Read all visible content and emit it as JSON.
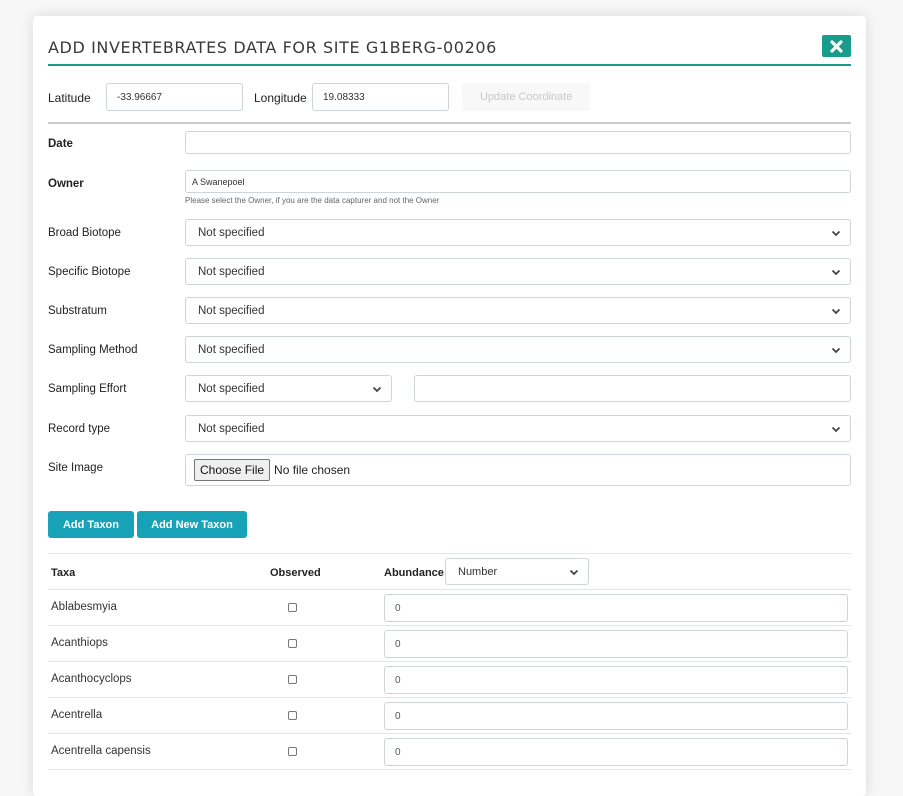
{
  "modal": {
    "title": "ADD INVERTEBRATES DATA FOR SITE G1BERG-00206",
    "close_icon": "close-icon",
    "accent_color": "#1a9c8c"
  },
  "coordinates": {
    "latitude_label": "Latitude",
    "latitude_value": "-33.96667",
    "longitude_label": "Longitude",
    "longitude_value": "19.08333",
    "update_button": "Update Coordinate"
  },
  "form": {
    "date": {
      "label": "Date",
      "value": ""
    },
    "owner": {
      "label": "Owner",
      "value": "A Swanepoel",
      "help": "Please select the Owner, if you are the data capturer and not the Owner"
    },
    "broad_biotope": {
      "label": "Broad Biotope",
      "value": "Not specified"
    },
    "specific_biotope": {
      "label": "Specific Biotope",
      "value": "Not specified"
    },
    "substratum": {
      "label": "Substratum",
      "value": "Not specified"
    },
    "sampling_method": {
      "label": "Sampling Method",
      "value": "Not specified"
    },
    "sampling_effort": {
      "label": "Sampling Effort",
      "value": "Not specified",
      "amount": ""
    },
    "record_type": {
      "label": "Record type",
      "value": "Not specified"
    },
    "site_image": {
      "label": "Site Image",
      "button": "Choose File",
      "status": "No file chosen"
    }
  },
  "actions": {
    "add_taxon": "Add Taxon",
    "add_new_taxon": "Add New Taxon",
    "button_color": "#17a2b8"
  },
  "taxa_table": {
    "headers": {
      "taxa": "Taxa",
      "observed": "Observed",
      "abundance": "Abundance"
    },
    "abundance_type": "Number",
    "rows": [
      {
        "name": "Ablabesmyia",
        "observed": false,
        "abundance": "0"
      },
      {
        "name": "Acanthiops",
        "observed": false,
        "abundance": "0"
      },
      {
        "name": "Acanthocyclops",
        "observed": false,
        "abundance": "0"
      },
      {
        "name": "Acentrella",
        "observed": false,
        "abundance": "0"
      },
      {
        "name": "Acentrella capensis",
        "observed": false,
        "abundance": "0"
      }
    ]
  }
}
